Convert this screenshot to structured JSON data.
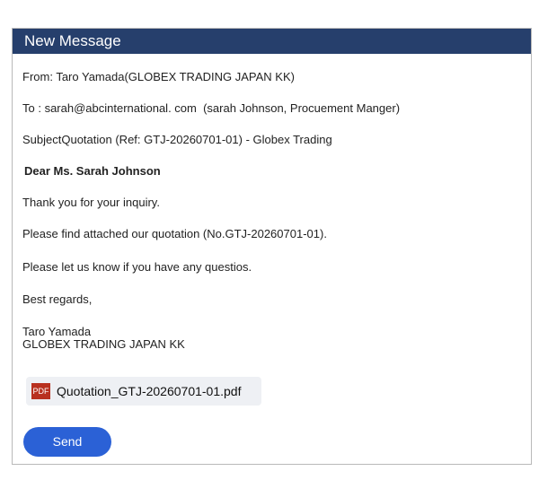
{
  "window": {
    "title": "New Message"
  },
  "email": {
    "from": "From: Taro Yamada(GLOBEX TRADING JAPAN KK)",
    "to": "To : sarah@abcinternational. com  (sarah Johnson, Procuement Manger)",
    "subject": "SubjectQuotation (Ref: GTJ-20260701-01) - Globex Trading",
    "greeting": "Dear Ms. Sarah Johnson",
    "body": [
      "Thank you for your inquiry.",
      "Please find attached our quotation (No.GTJ-20260701-01).",
      "Please let us know if you have any questios.",
      "Best regards,"
    ],
    "signature": [
      "Taro Yamada",
      "GLOBEX TRADING JAPAN KK"
    ]
  },
  "attachment": {
    "icon": "PDF",
    "icon_color": "#b8301f",
    "filename": "Quotation_GTJ-20260701-01.pdf"
  },
  "actions": {
    "send_label": "Send",
    "send_color": "#2b61d6"
  },
  "colors": {
    "titlebar": "#263f6c"
  }
}
